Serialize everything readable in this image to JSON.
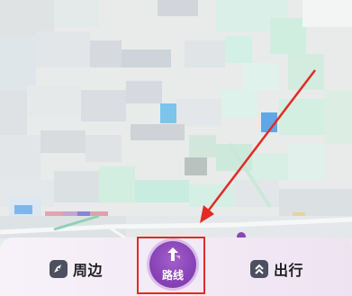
{
  "map": {
    "description_icons": [
      "location-pin-icon",
      "compass-icon"
    ]
  },
  "bottom_nav": {
    "nearby": {
      "label": "周边",
      "icon": "compass-icon"
    },
    "route": {
      "label": "路线",
      "icon": "up-arrow-route-icon"
    },
    "travel": {
      "label": "出行",
      "icon": "double-chevron-up-icon"
    }
  },
  "annotation": {
    "color": "#e12b24"
  },
  "colors": {
    "route_purple": "#8a45b8",
    "nav_icon_bg": "#4c5060"
  }
}
